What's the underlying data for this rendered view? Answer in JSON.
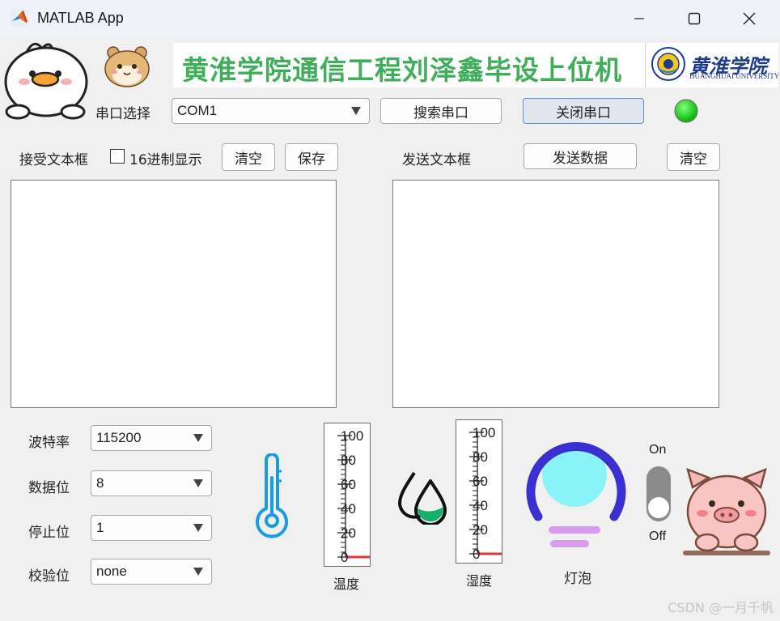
{
  "window": {
    "title": "MATLAB App",
    "minimize_icon": "minimize-icon",
    "maximize_icon": "maximize-icon",
    "close_icon": "close-icon"
  },
  "banner": {
    "text": "黄淮学院通信工程刘泽鑫毕设上位机",
    "school_name_cn": "黄淮学院",
    "school_name_en": "HUANGHUAI UNIVERSITY",
    "accent_color": "#3fae5a"
  },
  "serial": {
    "port_label": "串口选择",
    "port_value": "COM1",
    "search_button": "搜索串口",
    "close_button": "关闭串口",
    "lamp_color": "#19d219"
  },
  "receive": {
    "label": "接受文本框",
    "hex_checkbox_label": "16进制显示",
    "hex_checked": false,
    "clear_button": "清空",
    "save_button": "保存"
  },
  "send": {
    "label": "发送文本框",
    "send_button": "发送数据",
    "clear_button": "清空"
  },
  "settings": {
    "baud": {
      "label": "波特率",
      "value": "115200"
    },
    "data_bits": {
      "label": "数据位",
      "value": "8"
    },
    "stop_bits": {
      "label": "停止位",
      "value": "1"
    },
    "parity": {
      "label": "校验位",
      "value": "none"
    }
  },
  "temperature": {
    "label": "温度",
    "ticks": [
      "100",
      "80",
      "60",
      "40",
      "20",
      "0"
    ],
    "value": 0,
    "icon": "thermometer-icon"
  },
  "humidity": {
    "label": "湿度",
    "ticks": [
      "100",
      "80",
      "60",
      "40",
      "20",
      "0"
    ],
    "value": 0,
    "icon": "water-drops-icon"
  },
  "lamp": {
    "label": "灯泡",
    "icon": "light-bulb-icon",
    "color": "#8af3f7"
  },
  "switch": {
    "on_label": "On",
    "off_label": "Off",
    "state": "off"
  },
  "watermark": "CSDN @一月千帆"
}
